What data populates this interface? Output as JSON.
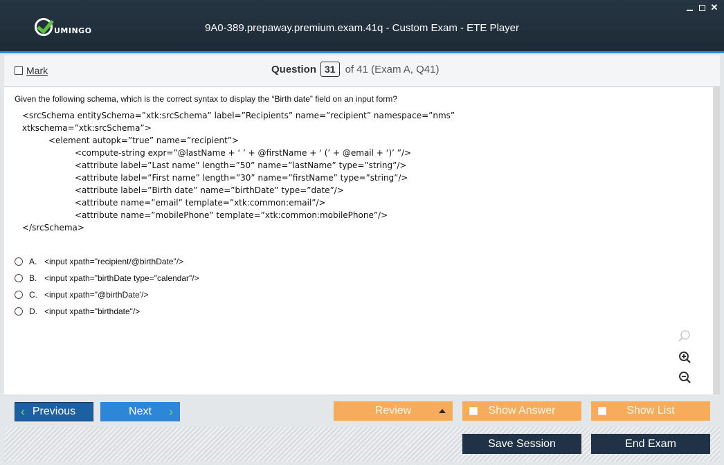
{
  "titlebar": {
    "logo_text": "UMINGO",
    "title": "9A0-389.prepaway.premium.exam.41q - Custom Exam - ETE Player"
  },
  "header": {
    "mark_label": "Mark",
    "question_label": "Question",
    "question_number": "31",
    "question_of": "of 41 (Exam A, Q41)"
  },
  "question": {
    "text": "Given the following schema, which is the correct syntax to display the “Birth date” field on an input form?",
    "schema_lines": [
      "<srcSchema entitySchema=”xtk:srcSchema” label=”Recipients” name=”recipient” namespace=”nms”",
      "xtkschema=”xtk:srcSchema”>",
      "<element autopk=”true” name=”recipient”>",
      "<compute-string expr=”@lastName + ‘ ’ + @firstName + ‘ (’ + @email + ‘)’ ”/>",
      "<attribute label=”Last name” length=”50” name=”lastName” type=”string”/>",
      "<attribute label=”First name” length=”30” name=”firstName” type=”string”/>",
      "<attribute label=”Birth date” name=”birthDate” type=”date”/>",
      "<attribute name=”email” template=”xtk:common:email”/>",
      "<attribute name=”mobilePhone” template=”xtk:common:mobilePhone”/>",
      "</srcSchema>"
    ],
    "options": [
      {
        "letter": "A.",
        "text": "<input xpath=\"recipient/@birthDate\"/>"
      },
      {
        "letter": "B.",
        "text": "<input xpath=\"birthDate type=\"calendar\"/>"
      },
      {
        "letter": "C.",
        "text": "<input xpath=\"@birthDate'/>"
      },
      {
        "letter": "D.",
        "text": "<input xpath=\"birthdate\"/>"
      }
    ]
  },
  "icons": {
    "zoom_reset": "magnifier-icon",
    "zoom_in": "zoom-in-icon",
    "zoom_out": "zoom-out-icon"
  },
  "footer": {
    "previous": "Previous",
    "next": "Next",
    "review": "Review",
    "show_answer": "Show Answer",
    "show_list": "Show List",
    "save_session": "Save Session",
    "end_exam": "End Exam"
  },
  "colors": {
    "titlebar": "#1d2b37",
    "accent": "#2d8ad8",
    "orange": "#f7ac5c",
    "dark_button": "#1f3246",
    "previous_button": "#1c5fa2",
    "next_button": "#2e86d8"
  }
}
